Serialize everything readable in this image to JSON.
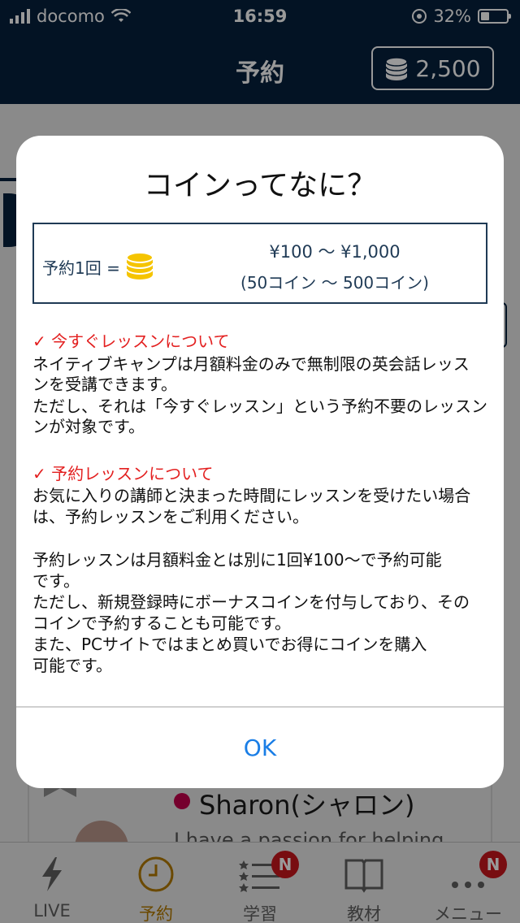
{
  "status_bar": {
    "carrier": "docomo",
    "time": "16:59",
    "battery_percent": "32%",
    "battery_level": 0.32
  },
  "nav": {
    "title": "予約",
    "coin_balance": "2,500",
    "coin_icon": "coin-stack-icon"
  },
  "background": {
    "teacher_name": "Sharon(シャロン)",
    "teacher_tagline": "I have a passion for helping"
  },
  "tabbar": {
    "items": [
      {
        "label": "LIVE",
        "icon": "lightning-icon"
      },
      {
        "label": "予約",
        "icon": "clock-icon",
        "active": true
      },
      {
        "label": "学習",
        "icon": "checklist-icon",
        "badge": "N"
      },
      {
        "label": "教材",
        "icon": "book-icon"
      },
      {
        "label": "メニュー",
        "icon": "more-icon",
        "badge": "N"
      }
    ],
    "active_color": "#b27a00"
  },
  "modal": {
    "title": "コインってなに？",
    "rate": {
      "label": "予約1回 =",
      "yen_range": "¥100 ～ ¥1,000",
      "coin_range": "(50コイン ～ 500コイン)"
    },
    "sections": [
      {
        "heading": "✓ 今すぐレッスンについて",
        "lines": [
          "ネイティブキャンプは月額料金のみで無制限の英会話レッス",
          "ンを受講できます。",
          "ただし、それは「今すぐレッスン」という予約不要のレッスン",
          "ンが対象です。"
        ]
      },
      {
        "heading": "✓ 予約レッスンについて",
        "lines": [
          "お気に入りの講師と決まった時間にレッスンを受けたい場合",
          "は、予約レッスンをご利用ください。",
          "",
          "予約レッスンは月額料金とは別に1回¥100～で予約可能",
          "です。",
          "ただし、新規登録時にボーナスコインを付与しており、その",
          "コインで予約することも可能です。",
          "また、PCサイトではまとめ買いでお得にコインを購入",
          "可能です。"
        ]
      }
    ],
    "ok_label": "OK"
  },
  "colors": {
    "navy": "#06203d",
    "alert_red": "#e32020",
    "link_blue": "#1a7ee6",
    "coin_gold": "#f5c400"
  }
}
